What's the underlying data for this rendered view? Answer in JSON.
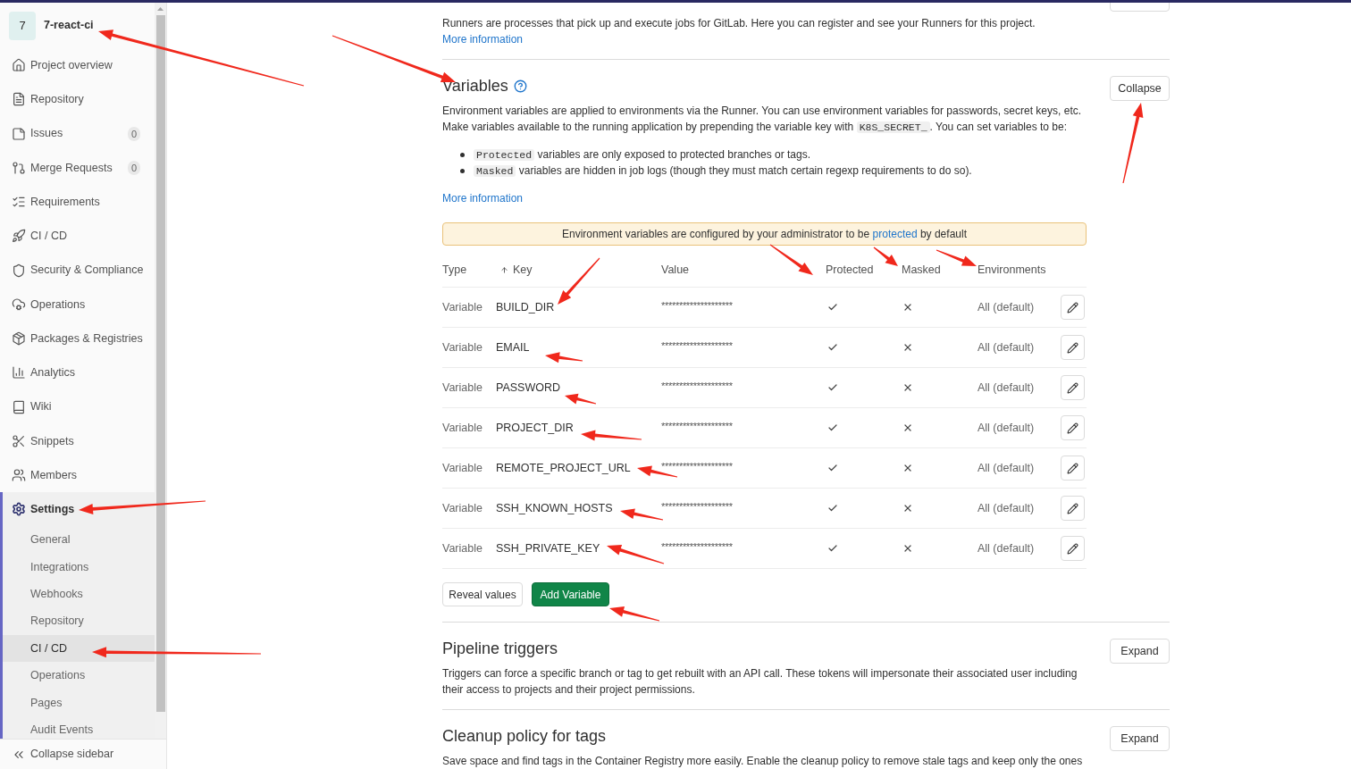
{
  "sidebar": {
    "project": {
      "avatar": "7",
      "name": "7-react-ci"
    },
    "items": [
      {
        "label": "Project overview",
        "selected": false
      },
      {
        "label": "Repository",
        "selected": false
      },
      {
        "label": "Issues",
        "count": "0",
        "selected": false
      },
      {
        "label": "Merge Requests",
        "count": "0",
        "selected": false
      },
      {
        "label": "Requirements",
        "selected": false
      },
      {
        "label": "CI / CD",
        "selected": false
      },
      {
        "label": "Security & Compliance",
        "selected": false
      },
      {
        "label": "Operations",
        "selected": false
      },
      {
        "label": "Packages & Registries",
        "selected": false
      },
      {
        "label": "Analytics",
        "selected": false
      },
      {
        "label": "Wiki",
        "selected": false
      },
      {
        "label": "Snippets",
        "selected": false
      },
      {
        "label": "Members",
        "selected": false
      },
      {
        "label": "Settings",
        "selected": true,
        "children": [
          {
            "label": "General",
            "selected": false
          },
          {
            "label": "Integrations",
            "selected": false
          },
          {
            "label": "Webhooks",
            "selected": false
          },
          {
            "label": "Repository",
            "selected": false
          },
          {
            "label": "CI / CD",
            "selected": true
          },
          {
            "label": "Operations",
            "selected": false
          },
          {
            "label": "Pages",
            "selected": false
          },
          {
            "label": "Audit Events",
            "selected": false
          }
        ]
      }
    ],
    "collapse_button": "Collapse sidebar"
  },
  "runners": {
    "description": "Runners are processes that pick up and execute jobs for GitLab. Here you can register and see your Runners for this project.",
    "link": "More information"
  },
  "variables": {
    "title": "Variables",
    "button": "Collapse",
    "intro": {
      "before": "Environment variables are applied to environments via the Runner. You can use environment variables for passwords, secret keys, etc. Make variables available to the running application by prepending the variable key with",
      "code": "K8S_SECRET_",
      "after": ". You can set variables to be:"
    },
    "bullets": [
      {
        "code": "Protected",
        "text": "variables are only exposed to protected branches or tags."
      },
      {
        "code": "Masked",
        "text": "variables are hidden in job logs (though they must match certain regexp requirements to do so)."
      }
    ],
    "more_link": "More information",
    "alert": {
      "before": "Environment variables are configured by your administrator to be",
      "link": "protected",
      "after": "by default"
    },
    "table": {
      "columns": [
        {
          "label": "Type",
          "sorted": false
        },
        {
          "label": "Key",
          "sorted": true
        },
        {
          "label": "Value",
          "sorted": false
        },
        {
          "label": "Protected",
          "sorted": false
        },
        {
          "label": "Masked",
          "sorted": false
        },
        {
          "label": "Environments",
          "sorted": false
        }
      ],
      "rows": [
        {
          "type": "Variable",
          "key": "BUILD_DIR",
          "value": "********************",
          "protected": true,
          "masked": false,
          "environments": "All (default)"
        },
        {
          "type": "Variable",
          "key": "EMAIL",
          "value": "********************",
          "protected": true,
          "masked": false,
          "environments": "All (default)"
        },
        {
          "type": "Variable",
          "key": "PASSWORD",
          "value": "********************",
          "protected": true,
          "masked": false,
          "environments": "All (default)"
        },
        {
          "type": "Variable",
          "key": "PROJECT_DIR",
          "value": "********************",
          "protected": true,
          "masked": false,
          "environments": "All (default)"
        },
        {
          "type": "Variable",
          "key": "REMOTE_PROJECT_URL",
          "value": "********************",
          "protected": true,
          "masked": false,
          "environments": "All (default)"
        },
        {
          "type": "Variable",
          "key": "SSH_KNOWN_HOSTS",
          "value": "********************",
          "protected": true,
          "masked": false,
          "environments": "All (default)"
        },
        {
          "type": "Variable",
          "key": "SSH_PRIVATE_KEY",
          "value": "********************",
          "protected": true,
          "masked": false,
          "environments": "All (default)"
        }
      ]
    },
    "actions": [
      {
        "label": "Reveal values",
        "kind": "secondary"
      },
      {
        "label": "Add Variable",
        "kind": "primary"
      }
    ]
  },
  "sections": [
    {
      "title": "Pipeline triggers",
      "button": "Expand",
      "description": "Triggers can force a specific branch or tag to get rebuilt with an API call. These tokens will impersonate their associated user including their access to projects and their project permissions."
    },
    {
      "title": "Cleanup policy for tags",
      "button": "Expand",
      "description": "Save space and find tags in the Container Registry more easily. Enable the cleanup policy to remove stale tags and keep only the ones"
    }
  ]
}
